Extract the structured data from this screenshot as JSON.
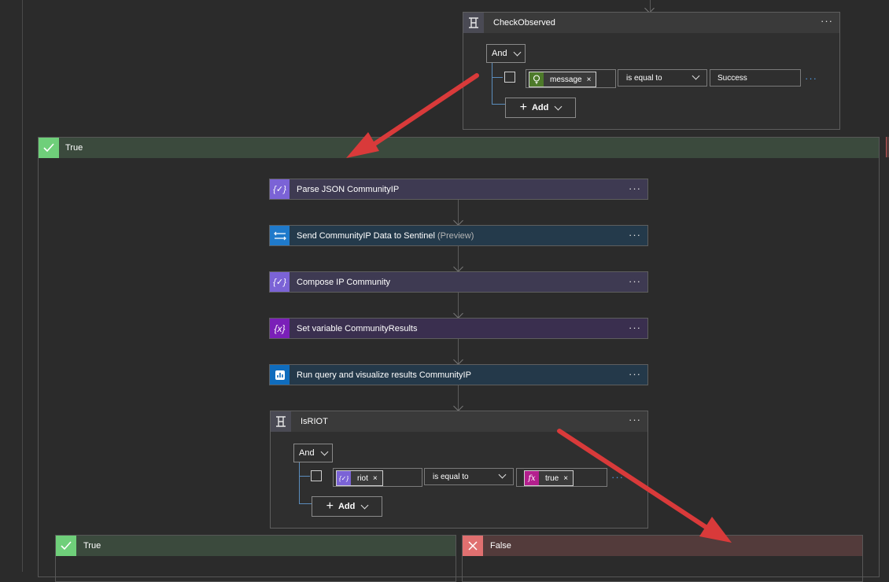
{
  "check_observed": {
    "title": "CheckObserved",
    "more": "···",
    "operator": "And",
    "token_label": "message",
    "token_remove": "×",
    "comparator": "is equal to",
    "value": "Success",
    "row_more": "···",
    "add_label": "Add"
  },
  "true_branch": {
    "label": "True"
  },
  "steps": [
    {
      "title": "Parse JSON CommunityIP",
      "suffix": "",
      "more": "···"
    },
    {
      "title": "Send CommunityIP Data to Sentinel",
      "suffix": " (Preview)",
      "more": "···"
    },
    {
      "title": "Compose IP Community",
      "suffix": "",
      "more": "···"
    },
    {
      "title": "Set variable CommunityResults",
      "suffix": "",
      "more": "···"
    },
    {
      "title": "Run query and visualize results CommunityIP",
      "suffix": "",
      "more": "···"
    }
  ],
  "is_riot": {
    "title": "IsRIOT",
    "more": "···",
    "operator": "And",
    "token_label": "riot",
    "token_remove": "×",
    "comparator": "is equal to",
    "value_token": "true",
    "value_remove": "×",
    "row_more": "···",
    "add_label": "Add"
  },
  "inner_true": {
    "label": "True"
  },
  "inner_false": {
    "label": "False"
  },
  "colors": {
    "canvas": "#2b2b2b",
    "condition_icon_bg": "#4a4a54",
    "true_header": "#3b4a3d",
    "true_check": "#6fcf7a",
    "false_header": "#533b3b",
    "false_x": "#e07070",
    "parse_json_bg": "#3e3a52",
    "parse_json_icon": "#7b63d6",
    "sentinel_bg": "#243a4b",
    "sentinel_icon": "#1f7acb",
    "compose_bg": "#3e3a52",
    "setvar_bg": "#3a2f4f",
    "setvar_icon": "#7a1fb8",
    "query_bg": "#24394a",
    "query_icon": "#0f6cbd",
    "annotation_arrow": "#d93a3a"
  }
}
